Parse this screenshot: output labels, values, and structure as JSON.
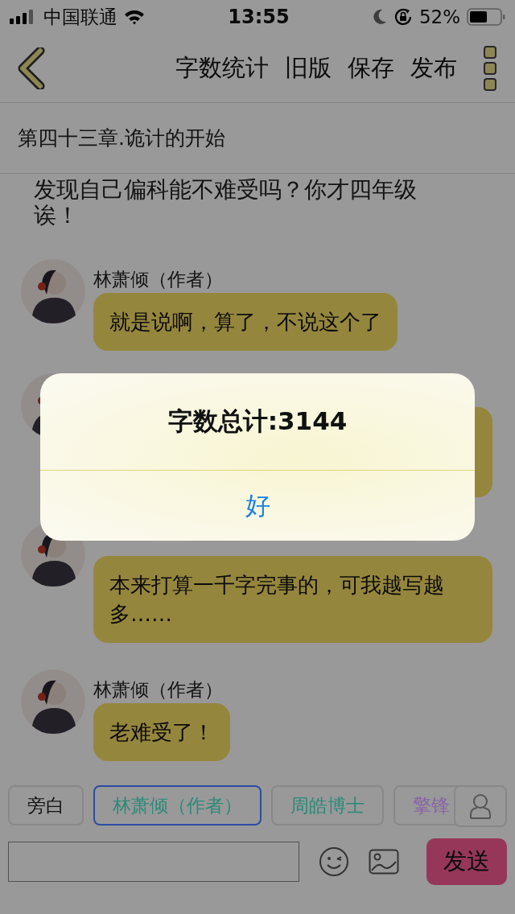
{
  "status_bar": {
    "carrier": "中国联通",
    "time": "13:55",
    "battery_text": "52%"
  },
  "nav": {
    "actions": [
      "字数统计",
      "旧版",
      "保存",
      "发布"
    ]
  },
  "chapter_title": "第四十三章.诡计的开始",
  "narration": "发现自己偏科能不难受吗？你才四年级诶！",
  "messages": [
    {
      "covered": false,
      "name": "林萧倾（作者）",
      "text": "就是说啊，算了，不说这个了"
    },
    {
      "covered": true
    },
    {
      "covered": false,
      "text": "本来打算一千字完事的，可我越写越多……"
    },
    {
      "covered": false,
      "name": "林萧倾（作者）",
      "text": "老难受了！"
    }
  ],
  "roles": [
    {
      "label": "旁白",
      "color": "#111111",
      "selected": false
    },
    {
      "label": "林萧倾（作者）",
      "color": "#2b8a78",
      "selected": true
    },
    {
      "label": "周皓博士",
      "color": "#2b8a78",
      "selected": false
    },
    {
      "label": "擎锋",
      "color": "#8a62a8",
      "selected": false
    }
  ],
  "composer": {
    "send": "发送"
  },
  "dialog": {
    "title": "字数总计:3144",
    "button": "好"
  }
}
